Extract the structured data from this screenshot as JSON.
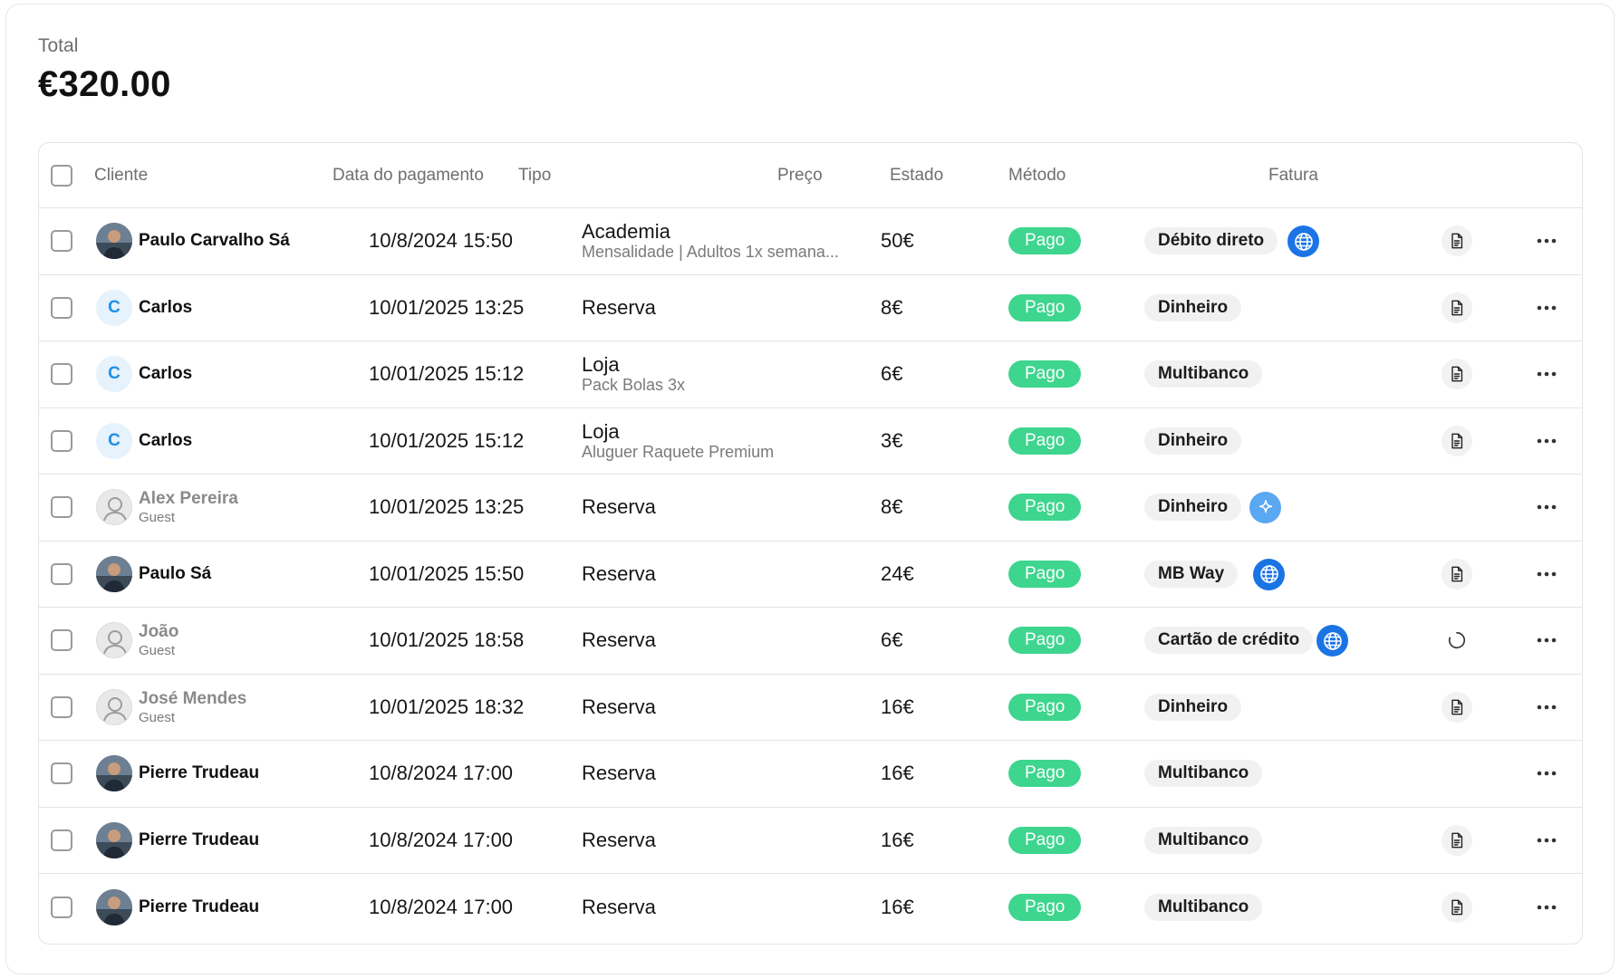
{
  "summary": {
    "label": "Total",
    "value": "€320.00"
  },
  "columns": [
    "Cliente",
    "Data do pagamento",
    "Tipo",
    "Preço",
    "Estado",
    "Método",
    "Fatura"
  ],
  "colors": {
    "paid": "#3ed58e",
    "globe": "#1b74e4",
    "sparkle": "#5aa7f2",
    "letter_avatar": "#1f8fe5"
  },
  "rows": [
    {
      "name": "Paulo Carvalho Sá",
      "sub": "",
      "avatar": "photo",
      "date": "10/8/2024 15:50",
      "tipo": "Academia",
      "tipo_sub": "Mensalidade | Adultos 1x semana...",
      "preco": "50€",
      "estado": "Pago",
      "metodo": "Débito direto",
      "channel": "globe-icon",
      "fatura": "document-icon"
    },
    {
      "name": "Carlos",
      "sub": "",
      "avatar": "letter",
      "avatar_letter": "C",
      "date": "10/01/2025 13:25",
      "tipo": "Reserva",
      "tipo_sub": "",
      "preco": "8€",
      "estado": "Pago",
      "metodo": "Dinheiro",
      "channel": "",
      "fatura": "document-icon"
    },
    {
      "name": "Carlos",
      "sub": "",
      "avatar": "letter",
      "avatar_letter": "C",
      "date": "10/01/2025 15:12",
      "tipo": "Loja",
      "tipo_sub": "Pack Bolas 3x",
      "preco": "6€",
      "estado": "Pago",
      "metodo": "Multibanco",
      "channel": "",
      "fatura": "document-icon"
    },
    {
      "name": "Carlos",
      "sub": "",
      "avatar": "letter",
      "avatar_letter": "C",
      "date": "10/01/2025 15:12",
      "tipo": "Loja",
      "tipo_sub": "Aluguer Raquete Premium",
      "preco": "3€",
      "estado": "Pago",
      "metodo": "Dinheiro",
      "channel": "",
      "fatura": "document-icon"
    },
    {
      "name": "Alex Pereira",
      "sub": "Guest",
      "avatar": "guest",
      "date": "10/01/2025 13:25",
      "tipo": "Reserva",
      "tipo_sub": "",
      "preco": "8€",
      "estado": "Pago",
      "metodo": "Dinheiro",
      "channel": "sparkle-icon",
      "fatura": ""
    },
    {
      "name": "Paulo Sá",
      "sub": "",
      "avatar": "photo",
      "date": "10/01/2025 15:50",
      "tipo": "Reserva",
      "tipo_sub": "",
      "preco": "24€",
      "estado": "Pago",
      "metodo": "MB Way",
      "channel": "globe-icon",
      "fatura": "document-icon"
    },
    {
      "name": "João",
      "sub": "Guest",
      "avatar": "guest",
      "date": "10/01/2025 18:58",
      "tipo": "Reserva",
      "tipo_sub": "",
      "preco": "6€",
      "estado": "Pago",
      "metodo": "Cartão de crédito",
      "channel": "globe-icon",
      "fatura": "loading-icon"
    },
    {
      "name": "José Mendes",
      "sub": "Guest",
      "avatar": "guest",
      "date": "10/01/2025 18:32",
      "tipo": "Reserva",
      "tipo_sub": "",
      "preco": "16€",
      "estado": "Pago",
      "metodo": "Dinheiro",
      "channel": "",
      "fatura": "document-icon"
    },
    {
      "name": "Pierre Trudeau",
      "sub": "",
      "avatar": "photo",
      "date": "10/8/2024 17:00",
      "tipo": "Reserva",
      "tipo_sub": "",
      "preco": "16€",
      "estado": "Pago",
      "metodo": "Multibanco",
      "channel": "",
      "fatura": ""
    },
    {
      "name": "Pierre Trudeau",
      "sub": "",
      "avatar": "photo",
      "date": "10/8/2024 17:00",
      "tipo": "Reserva",
      "tipo_sub": "",
      "preco": "16€",
      "estado": "Pago",
      "metodo": "Multibanco",
      "channel": "",
      "fatura": "document-icon"
    },
    {
      "name": "Pierre Trudeau",
      "sub": "",
      "avatar": "photo",
      "date": "10/8/2024 17:00",
      "tipo": "Reserva",
      "tipo_sub": "",
      "preco": "16€",
      "estado": "Pago",
      "metodo": "Multibanco",
      "channel": "",
      "fatura": "document-icon"
    }
  ]
}
